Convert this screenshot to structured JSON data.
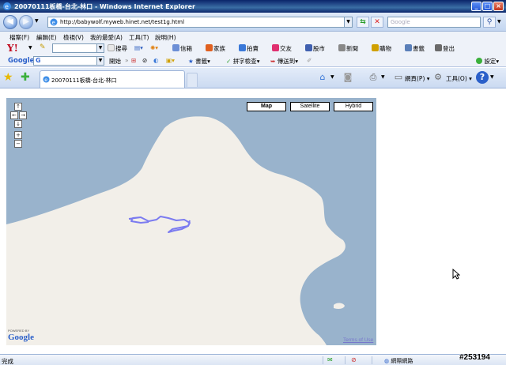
{
  "window": {
    "title": "20070111板橋-台北-林口 - Windows Internet Explorer",
    "minimize": "_",
    "maximize": "□",
    "close": "×"
  },
  "address": {
    "url": "http://babywolf.myweb.hinet.net/test1g.html",
    "search_placeholder": "Google"
  },
  "menu": [
    "檔案(F)",
    "編輯(E)",
    "檢視(V)",
    "我的最愛(A)",
    "工具(T)",
    "說明(H)"
  ],
  "yahoo_toolbar": {
    "search_button": "搜尋",
    "items": [
      "信箱",
      "家族",
      "拍賣",
      "交友",
      "股市",
      "新聞",
      "購物",
      "書籤",
      "登出"
    ]
  },
  "google_toolbar": {
    "logo": "Google",
    "go_button": "開始",
    "bookmarks": "書籤",
    "spellcheck": "拼字檢查",
    "send_to": "傳送到",
    "settings": "設定"
  },
  "tabs": {
    "active": "20070111板橋-台北-林口"
  },
  "command_bar": {
    "page": "網頁(P)",
    "tools": "工具(O)"
  },
  "map": {
    "buttons": [
      "Map",
      "Satellite",
      "Hybrid"
    ],
    "selected": "Map",
    "pan_up": "↑",
    "pan_left": "←",
    "pan_right": "→",
    "pan_down": "↓",
    "zoom_in": "+",
    "zoom_out": "−",
    "powered_by": "POWERED BY",
    "google_logo": "Google",
    "terms": "Terms of Use"
  },
  "status": {
    "text": "完成",
    "zone": "網際網路",
    "zoom": "100%"
  },
  "watermark": "#253194",
  "colors": {
    "water": "#99b3cc",
    "land": "#f2efe9",
    "route": "#7b7bf0",
    "titlebar": "#0a246a"
  }
}
